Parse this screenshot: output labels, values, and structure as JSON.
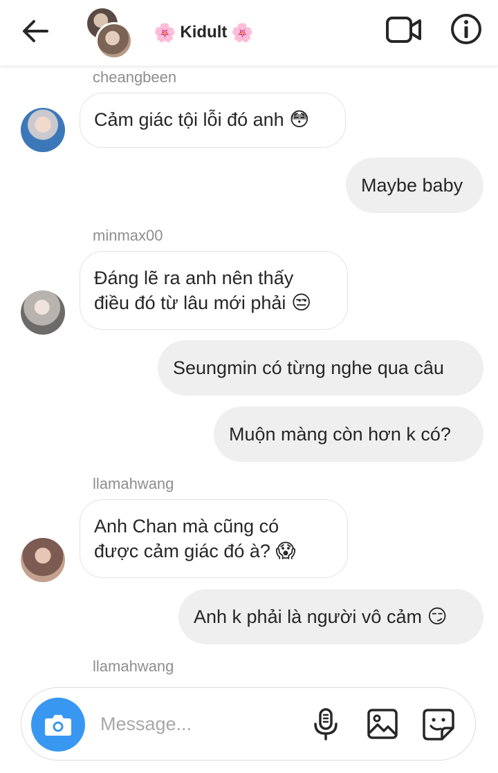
{
  "header": {
    "title": "Kidult",
    "title_decoration": "🌸"
  },
  "messages": [
    {
      "sender": "cheangbeen",
      "text": "Cảm giác tội lỗi đó anh",
      "emoji": "😳"
    },
    {
      "text": "Maybe baby"
    },
    {
      "sender": "minmax00",
      "line1": "Đáng lẽ ra anh nên thấy",
      "line2": "điều đó từ lâu mới phải",
      "emoji": "😒"
    },
    {
      "text": "Seungmin có từng nghe qua câu"
    },
    {
      "text": "Muộn màng còn hơn k có?"
    },
    {
      "sender": "llamahwang",
      "line1": "Anh Chan mà cũng có",
      "line2": "được cảm giác đó à?",
      "emoji": "😱"
    },
    {
      "text": "Anh k phải là người vô cảm",
      "emoji": "😏"
    },
    {
      "sender": "llamahwang"
    }
  ],
  "composer": {
    "placeholder": "Message..."
  },
  "icons": {
    "back": "arrow-left-icon",
    "video": "video-camera-icon",
    "info": "info-icon",
    "camera": "camera-icon",
    "mic": "microphone-icon",
    "gallery": "image-icon",
    "sticker": "sticker-icon"
  },
  "colors": {
    "accent": "#3897f0",
    "outgoing_bubble": "#efefef",
    "incoming_border": "#e3e3e3",
    "sender_text": "#8e8e8e"
  }
}
